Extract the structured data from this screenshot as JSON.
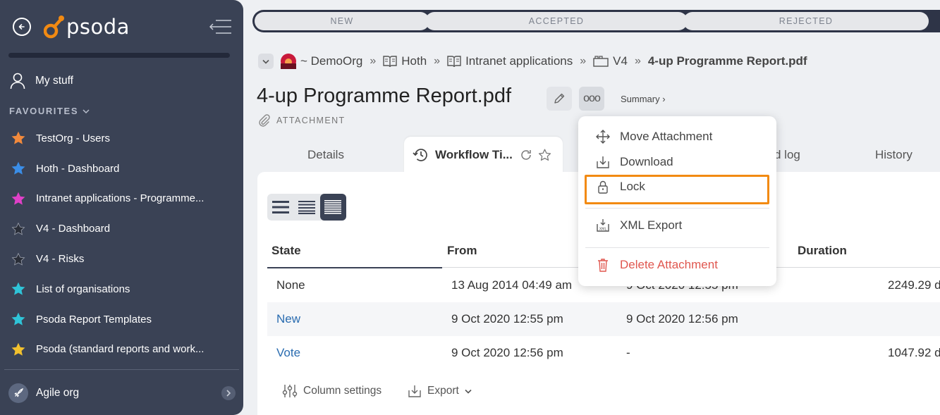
{
  "sidebar": {
    "logo_text": "psoda",
    "my_stuff": "My stuff",
    "favourites_header": "FAVOURITES",
    "favourites": [
      {
        "label": "TestOrg - Users",
        "star_color": "#f28a3c"
      },
      {
        "label": "Hoth - Dashboard",
        "star_color": "#3b8ee8"
      },
      {
        "label": "Intranet applications - Programme...",
        "star_color": "#e040c8"
      },
      {
        "label": "V4 - Dashboard",
        "star_color": "#2a2e38"
      },
      {
        "label": "V4 - Risks",
        "star_color": "#2a2e38"
      },
      {
        "label": "List of organisations",
        "star_color": "#2fc4d8"
      },
      {
        "label": "Psoda Report Templates",
        "star_color": "#2fc4d8"
      },
      {
        "label": "Psoda (standard reports and work...",
        "star_color": "#f2c12e"
      }
    ],
    "org_name": "Agile org"
  },
  "workflow": {
    "stages": [
      "NEW",
      "ACCEPTED",
      "REJECTED"
    ]
  },
  "breadcrumb": {
    "items": [
      "~ DemoOrg",
      "Hoth",
      "Intranet applications",
      "V4"
    ],
    "current": "4-up Programme Report.pdf",
    "separator": "»"
  },
  "page": {
    "title": "4-up Programme Report.pdf",
    "type": "ATTACHMENT",
    "summary_link": "Summary ›",
    "more_label": "ooo"
  },
  "tabs": {
    "details": "Details",
    "active": "Workflow Ti...",
    "log_partial": "d log",
    "history": "History"
  },
  "table": {
    "columns": [
      "State",
      "From",
      "Duration"
    ],
    "rows": [
      {
        "state": "None",
        "from": "13 Aug 2014 04:49 am",
        "to": "9 Oct 2020 12:55 pm",
        "duration": "2249.29 d",
        "link": false
      },
      {
        "state": "New",
        "from": "9 Oct 2020 12:55 pm",
        "to": "9 Oct 2020 12:56 pm",
        "duration": "",
        "link": true
      },
      {
        "state": "Vote",
        "from": "9 Oct 2020 12:56 pm",
        "to": "-",
        "duration": "1047.92 d",
        "link": true
      }
    ]
  },
  "footer": {
    "column_settings": "Column settings",
    "export": "Export"
  },
  "menu": {
    "items": [
      "Move Attachment",
      "Download",
      "Lock",
      "XML Export",
      "Delete Attachment"
    ],
    "highlighted": "Lock"
  },
  "colors": {
    "sidebar_bg": "#3a4255",
    "accent_orange": "#f28a12",
    "link_blue": "#2a6cb0",
    "danger_red": "#e0574f"
  }
}
